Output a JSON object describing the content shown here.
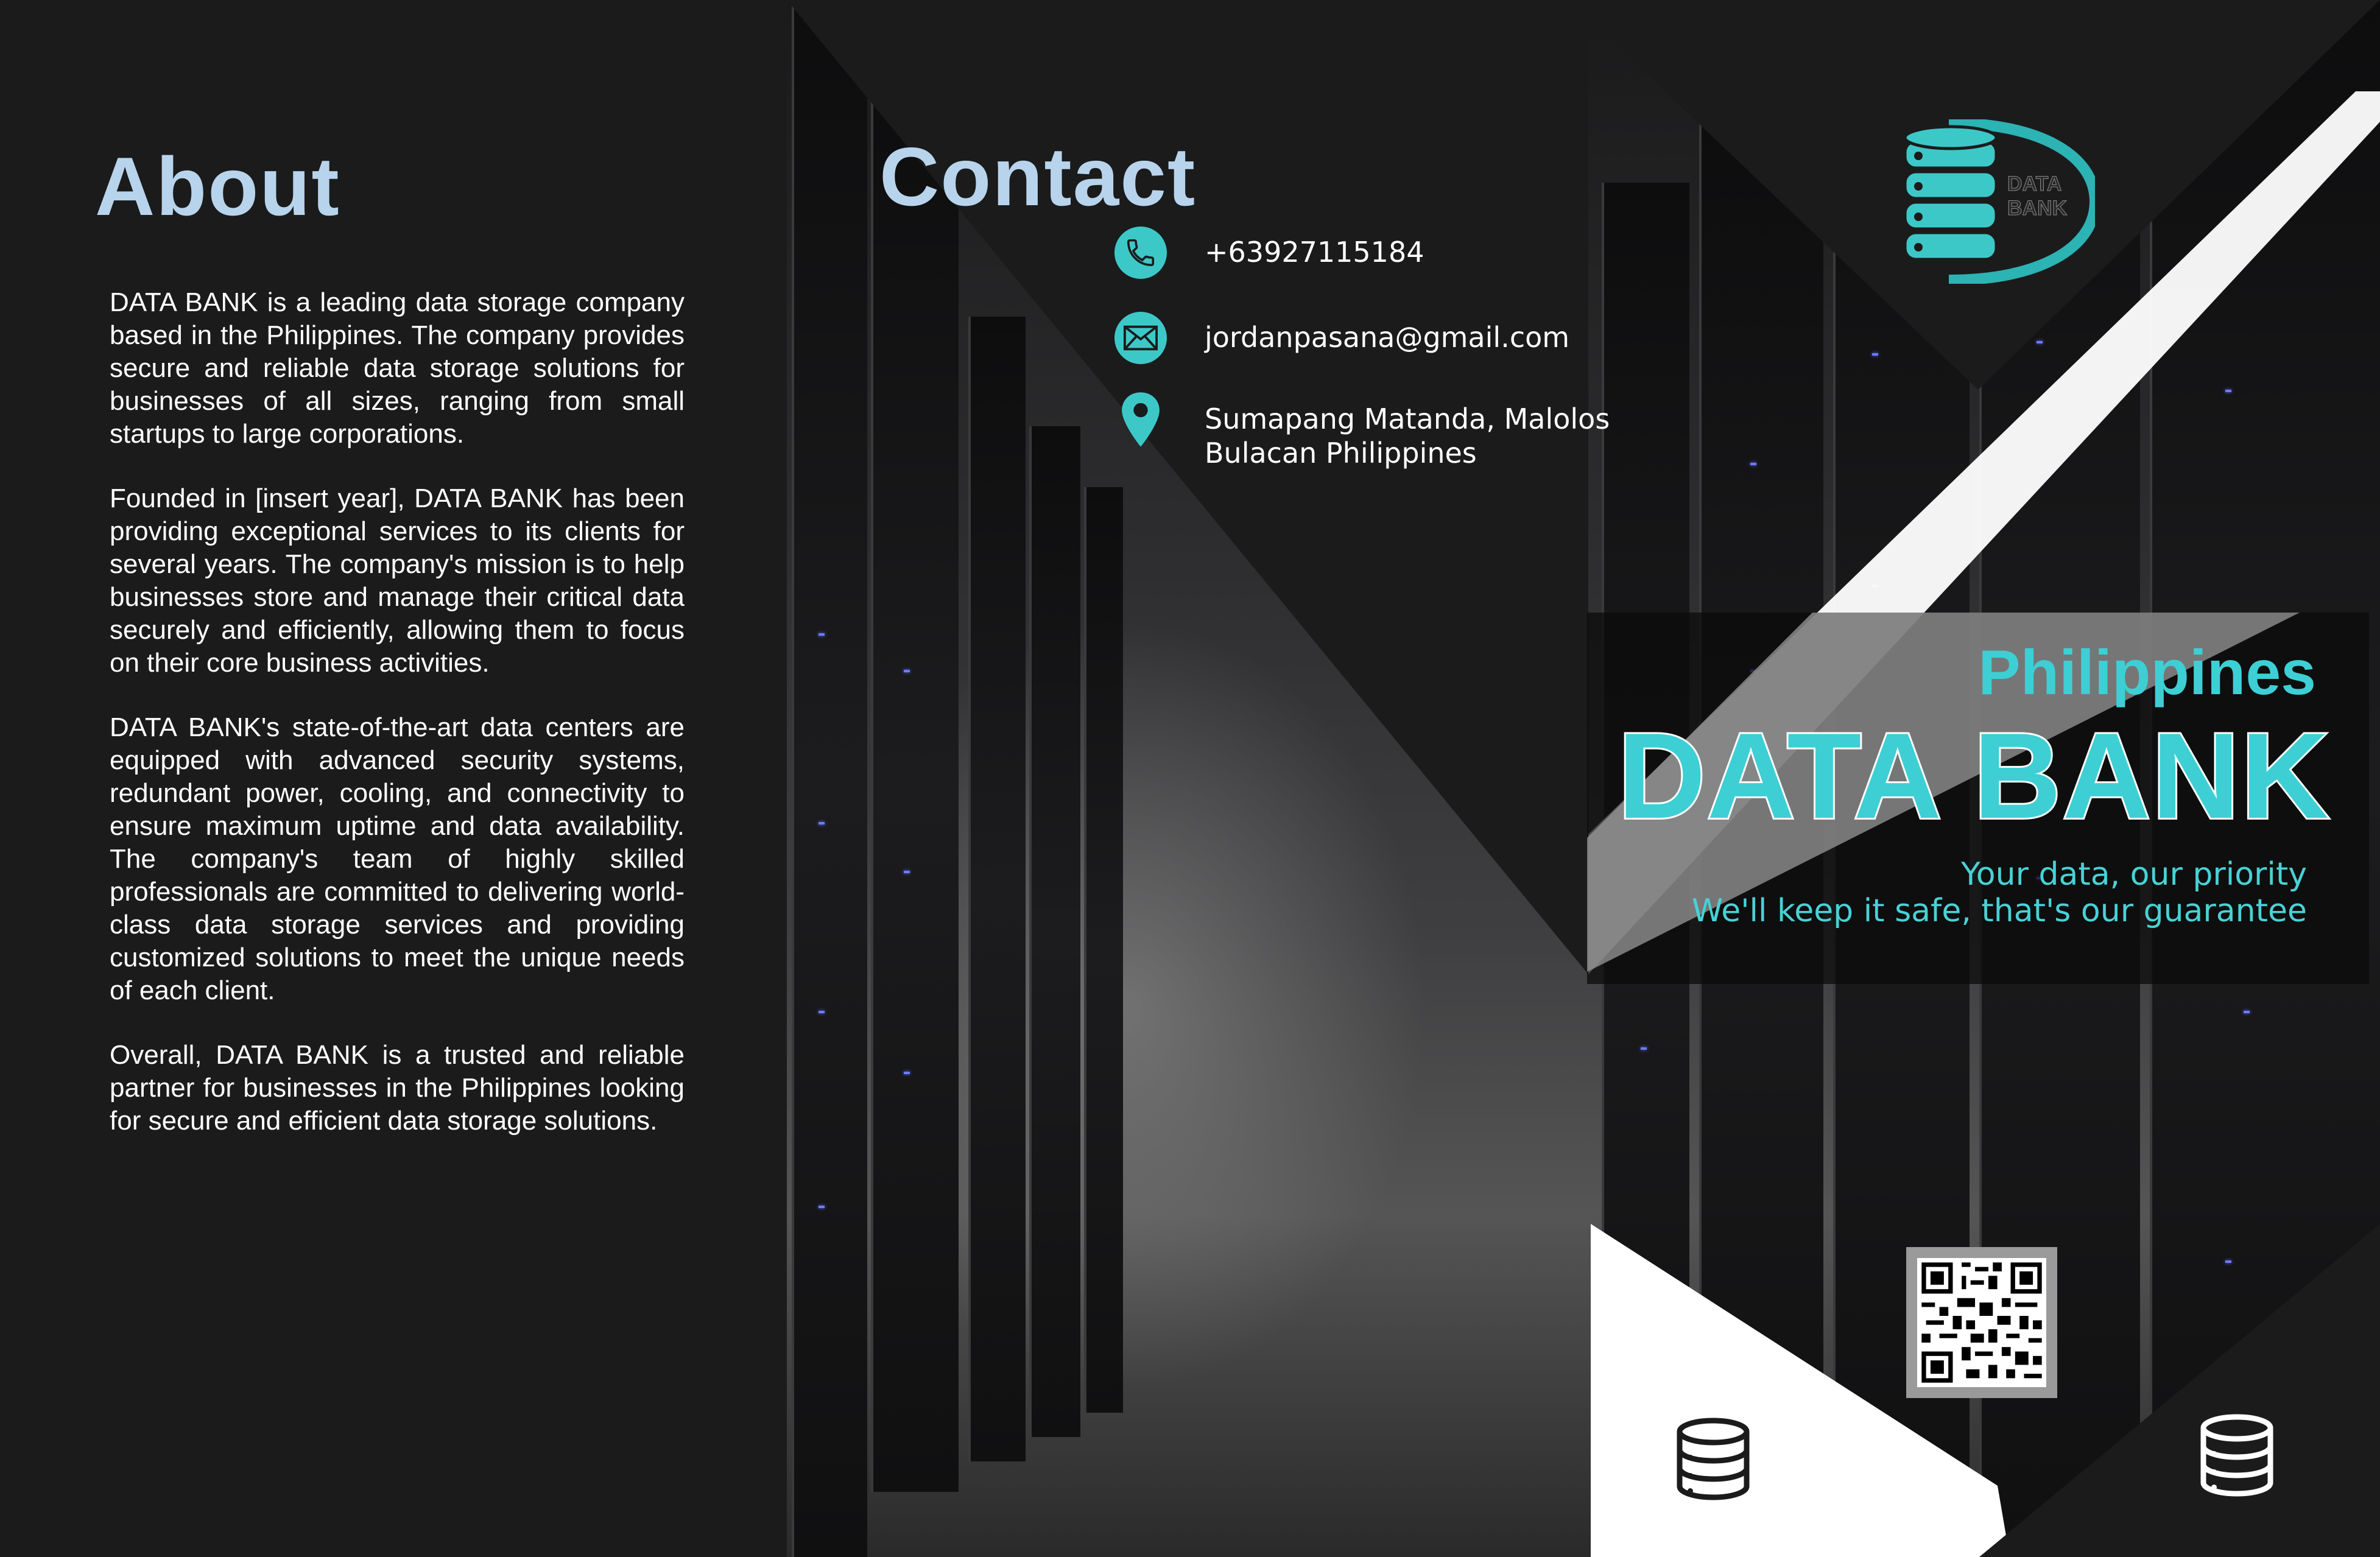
{
  "about": {
    "title": "About",
    "paragraphs": [
      "DATA BANK is a leading data storage company based in the Philippines. The company provides secure and reliable data storage solutions for businesses of all sizes, ranging from small startups to large corporations.",
      "Founded in [insert year], DATA BANK has been providing exceptional services to its clients for several years. The company's mission is to help businesses store and manage their critical data securely and efficiently, allowing them to focus on their core business activities.",
      "DATA BANK's state-of-the-art data centers are equipped with advanced security systems, redundant power, cooling, and connectivity to ensure maximum uptime and data availability. The company's team of highly skilled professionals are committed to delivering world-class data storage services and providing customized solutions to meet the unique needs of each client.",
      "Overall, DATA BANK is a trusted and reliable partner for businesses in the Philippines looking for secure and efficient data storage solutions."
    ]
  },
  "contact": {
    "title": "Contact",
    "phone": "+63927115184",
    "email": "jordanpasana@gmail.com",
    "address_line1": "Sumapang Matanda, Malolos",
    "address_line2": "Bulacan Philippines",
    "icons": [
      "phone-icon",
      "mail-icon",
      "location-pin-icon"
    ]
  },
  "cover": {
    "logo_line1": "DATA",
    "logo_line2": "BANK",
    "country": "Philippines",
    "title": "DATA BANK",
    "tagline1": "Your data, our priority",
    "tagline2": "We'll keep it safe, that's our guarantee",
    "icons": [
      "database-logo-icon",
      "qr-code",
      "database-icon",
      "database-icon"
    ]
  },
  "colors": {
    "background": "#1b1b1c",
    "heading": "#b8d4ec",
    "accent": "#3dcfd4",
    "text": "#ffffff"
  }
}
